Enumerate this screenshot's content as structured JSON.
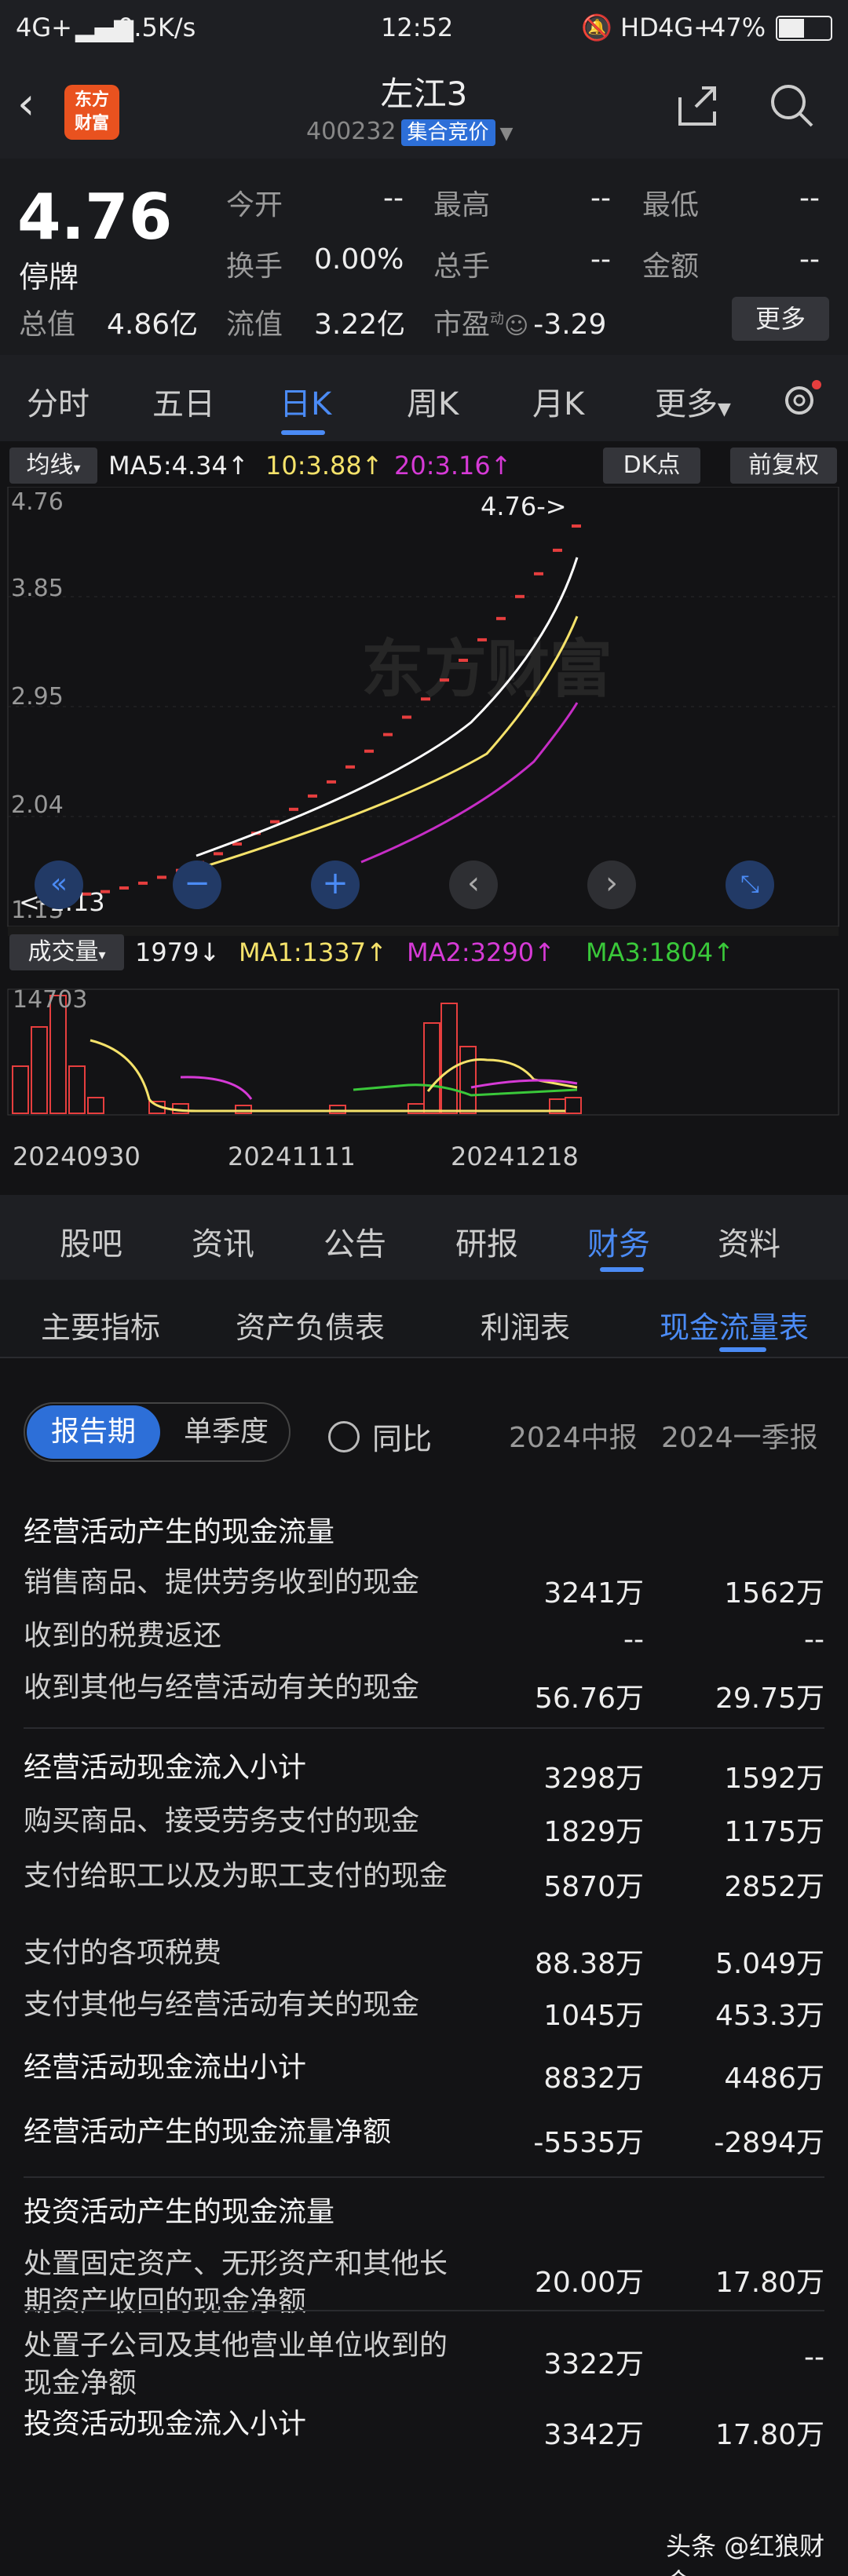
{
  "status_bar": {
    "network": "4G+",
    "speed": "0.5K/s",
    "time": "12:52",
    "hd": "HD",
    "net2": "4G+",
    "battery": "47%"
  },
  "header": {
    "logo_line1": "东方",
    "logo_line2": "财富",
    "name": "左江3",
    "code": "400232",
    "badge": "集合竞价"
  },
  "quote": {
    "price": "4.76",
    "status": "停牌",
    "open_lbl": "今开",
    "open": "--",
    "high_lbl": "最高",
    "high": "--",
    "low_lbl": "最低",
    "low": "--",
    "turnover_lbl": "换手",
    "turnover": "0.00%",
    "volume_lbl": "总手",
    "volume": "--",
    "amount_lbl": "金额",
    "amount": "--",
    "mktcap_lbl": "总值",
    "mktcap": "4.86亿",
    "float_lbl": "流值",
    "float": "3.22亿",
    "pe_lbl": "市盈",
    "pe_sup": "动",
    "pe": "-3.29",
    "more": "更多"
  },
  "period_tabs": [
    "分时",
    "五日",
    "日K",
    "周K",
    "月K",
    "更多"
  ],
  "chart": {
    "ma_label": "均线",
    "ma5": "MA5:4.34",
    "ma10": "10:3.88",
    "ma20": "20:3.16",
    "dk": "DK点",
    "adjust": "前复权",
    "y_ticks": [
      "4.76",
      "3.85",
      "2.95",
      "2.04",
      "1.13"
    ],
    "high_marker": "4.76->",
    "low_marker": "<-1.13",
    "vol_label": "成交量",
    "vol": "1979",
    "vma1": "MA1:1337",
    "vma2": "MA2:3290",
    "vma3": "MA3:1804",
    "vol_max": "14703",
    "dates": [
      "20240930",
      "20241111",
      "20241218"
    ]
  },
  "chart_data": {
    "type": "line",
    "x": [
      "20240930",
      "20241111",
      "20241218"
    ],
    "ylim": [
      1.13,
      4.76
    ],
    "series": [
      {
        "name": "MA5",
        "values": [
          1.2,
          2.0,
          4.34
        ]
      },
      {
        "name": "MA10",
        "values": [
          1.15,
          1.8,
          3.88
        ]
      },
      {
        "name": "MA20",
        "values": [
          1.13,
          1.6,
          3.16
        ]
      }
    ],
    "volume": {
      "max": 14703,
      "latest": 1979,
      "MA1": 1337,
      "MA2": 3290,
      "MA3": 1804
    }
  },
  "bottom_tabs": [
    "股吧",
    "资讯",
    "公告",
    "研报",
    "财务",
    "资料"
  ],
  "sub_tabs": [
    "主要指标",
    "资产负债表",
    "利润表",
    "现金流量表"
  ],
  "table": {
    "toggle_on": "报告期",
    "toggle_off": "单季度",
    "yoy": "同比",
    "col1": "2024中报",
    "col2": "2024一季报",
    "rows": [
      {
        "label": "经营活动产生的现金流量",
        "v1": "",
        "v2": ""
      },
      {
        "label": "销售商品、提供劳务收到的现金",
        "v1": "3241万",
        "v2": "1562万"
      },
      {
        "label": "收到的税费返还",
        "v1": "--",
        "v2": "--"
      },
      {
        "label": "收到其他与经营活动有关的现金",
        "v1": "56.76万",
        "v2": "29.75万"
      },
      {
        "label": "经营活动现金流入小计",
        "v1": "3298万",
        "v2": "1592万"
      },
      {
        "label": "购买商品、接受劳务支付的现金",
        "v1": "1829万",
        "v2": "1175万"
      },
      {
        "label": "支付给职工以及为职工支付的现金",
        "v1": "5870万",
        "v2": "2852万"
      },
      {
        "label": "支付的各项税费",
        "v1": "88.38万",
        "v2": "5.049万"
      },
      {
        "label": "支付其他与经营活动有关的现金",
        "v1": "1045万",
        "v2": "453.3万"
      },
      {
        "label": "经营活动现金流出小计",
        "v1": "8832万",
        "v2": "4486万"
      },
      {
        "label": "经营活动产生的现金流量净额",
        "v1": "-5535万",
        "v2": "-2894万"
      },
      {
        "label": "投资活动产生的现金流量",
        "v1": "",
        "v2": ""
      },
      {
        "label": "处置固定资产、无形资产和其他长期资产收回的现金净额",
        "v1": "20.00万",
        "v2": "17.80万"
      },
      {
        "label": "处置子公司及其他营业单位收到的现金净额",
        "v1": "3322万",
        "v2": "--"
      },
      {
        "label": "投资活动现金流入小计",
        "v1": "3342万",
        "v2": "17.80万"
      }
    ]
  },
  "watermark": "头条 @红狼财金"
}
